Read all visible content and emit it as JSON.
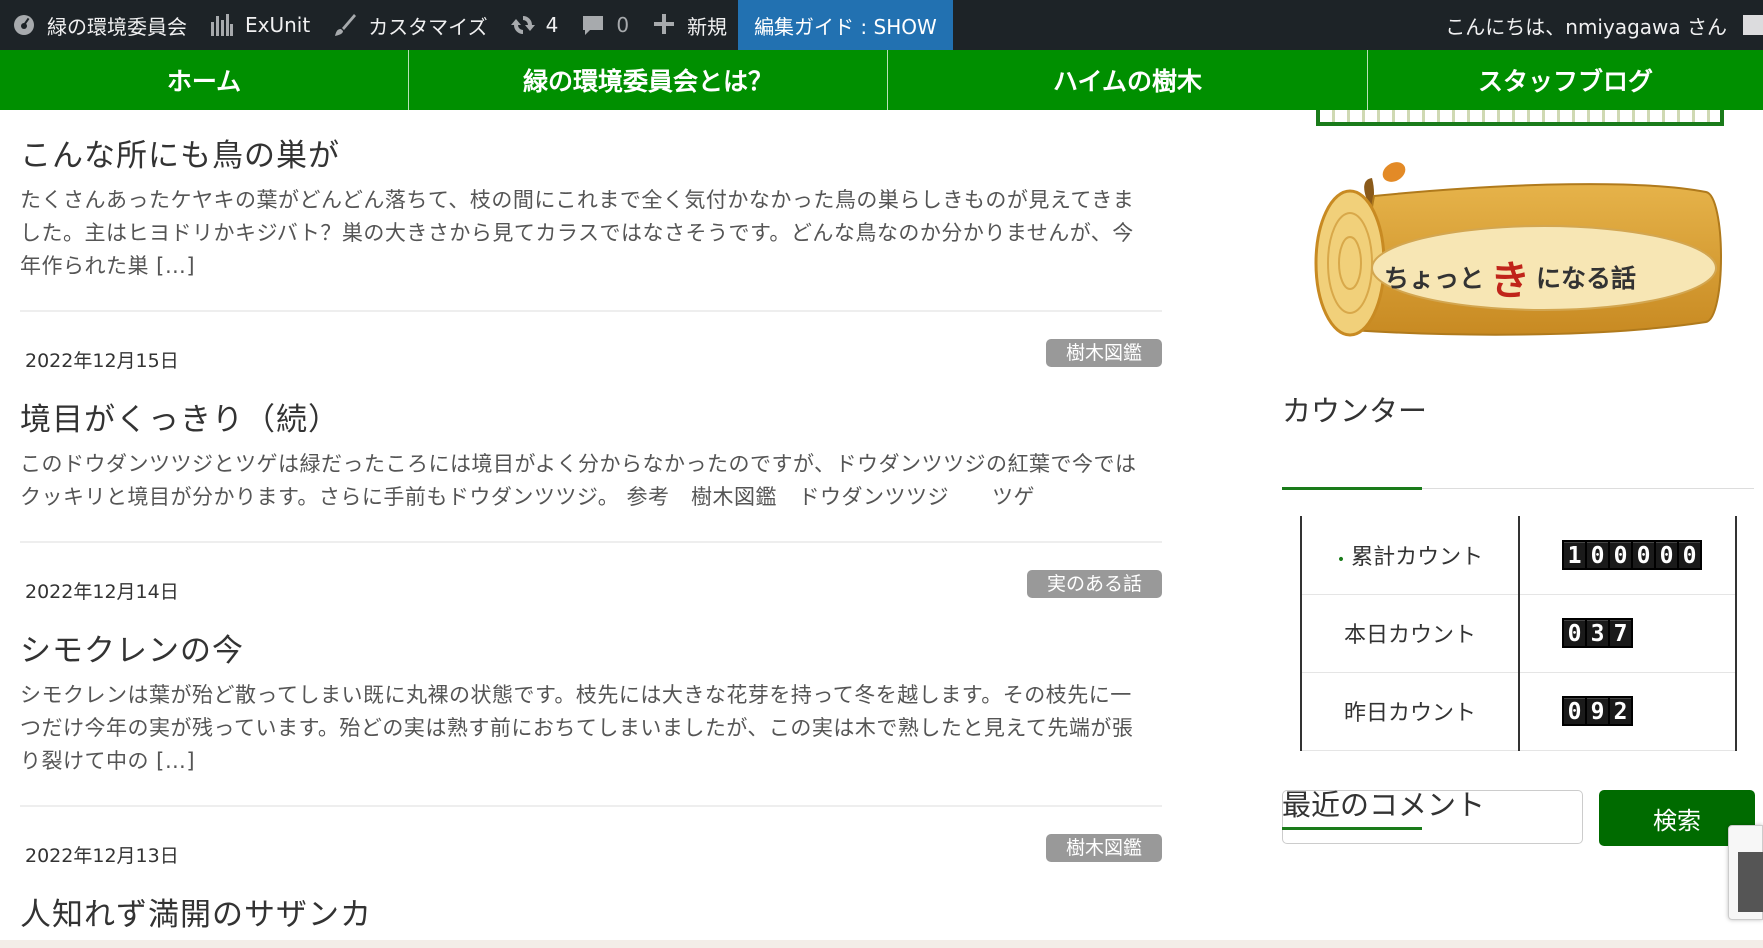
{
  "admin_bar": {
    "site_name": "緑の環境委員会",
    "exunit": "ExUnit",
    "customize": "カスタマイズ",
    "updates_count": "4",
    "comments_count": "0",
    "new": "新規",
    "edit_guide": "編集ガイド : SHOW",
    "greeting": "こんにちは、nmiyagawa さん",
    "icons": [
      "dashboard-icon",
      "exunit-icon",
      "brush-icon",
      "refresh-icon",
      "comment-icon",
      "plus-icon"
    ]
  },
  "nav": {
    "items": [
      {
        "label": "ホーム"
      },
      {
        "label": "緑の環境委員会とは？"
      },
      {
        "label": "ハイムの樹木"
      },
      {
        "label": "スタッフブログ"
      }
    ],
    "color": "#008f00"
  },
  "posts": [
    {
      "date": "",
      "category": "",
      "title": "こんな所にも鳥の巣が",
      "excerpt_lines": [
        "たくさんあったケヤキの葉がどんどん落ちて、枝の間にこれまで全く気付かなかった鳥の巣らしきものが見えてきま",
        "した。主はヒヨドリかキジバト？巣の大きさから見てカラスではなさそうです。どんな鳥なのか分かりませんが、今",
        "年作られた巣 […]"
      ]
    },
    {
      "date": "2022年12月15日",
      "category": "樹木図鑑",
      "title": "境目がくっきり（続）",
      "excerpt_lines": [
        "このドウダンツツジとツゲは緑だったころには境目がよく分からなかったのですが、ドウダンツツジの紅葉で今では",
        "クッキリと境目が分かります。さらに手前もドウダンツツジ。 参考　樹木図鑑　ドウダンツツジ　　ツゲ"
      ]
    },
    {
      "date": "2022年12月14日",
      "category": "実のある話",
      "title": "シモクレンの今",
      "excerpt_lines": [
        "シモクレンは葉が殆ど散ってしまい既に丸裸の状態です。枝先には大きな花芽を持って冬を越します。その枝先に一",
        "つだけ今年の実が残っています。殆どの実は熟す前におちてしまいましたが、この実は木で熟したと見えて先端が張",
        "り裂けて中の […]"
      ]
    },
    {
      "date": "2022年12月13日",
      "category": "樹木図鑑",
      "title": "人知れず満開のサザンカ",
      "excerpt_lines": []
    }
  ],
  "sidebar": {
    "banner_text": "ちょっと",
    "banner_kanji": "き",
    "banner_text_after": "になる話",
    "counter_title": "カウンター",
    "counter_rows": [
      {
        "label": "累計カウント",
        "digits": [
          "1",
          "0",
          "0",
          "0",
          "0",
          "0"
        ]
      },
      {
        "label": "本日カウント",
        "digits": [
          "0",
          "3",
          "7"
        ]
      },
      {
        "label": "昨日カウント",
        "digits": [
          "0",
          "9",
          "2"
        ]
      }
    ],
    "search_button": "検索",
    "search_placeholder": "",
    "recent_comments_title": "最近のコメント",
    "accent_color": "#1a7b1a"
  }
}
